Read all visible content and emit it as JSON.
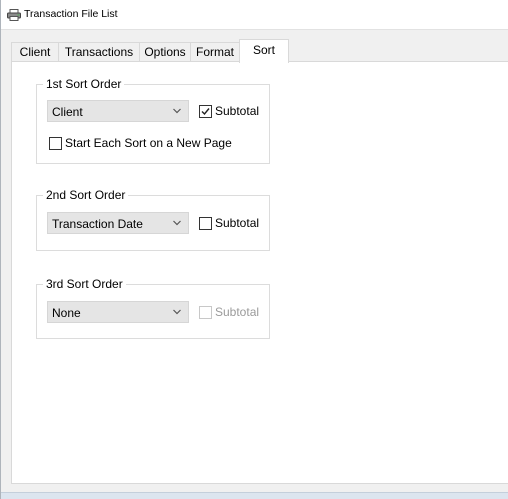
{
  "window": {
    "title": "Transaction File List",
    "title_icon": "printer-icon"
  },
  "tabs": [
    {
      "label": "Client"
    },
    {
      "label": "Transactions"
    },
    {
      "label": "Options"
    },
    {
      "label": "Format"
    },
    {
      "label": "Sort",
      "active": true
    }
  ],
  "sort_groups": [
    {
      "legend": "1st Sort Order",
      "combo_value": "Client",
      "subtotal_label": "Subtotal",
      "subtotal_checked": true,
      "subtotal_enabled": true,
      "new_page_label": "Start Each Sort on a New Page",
      "new_page_checked": false
    },
    {
      "legend": "2nd Sort Order",
      "combo_value": "Transaction Date",
      "subtotal_label": "Subtotal",
      "subtotal_checked": false,
      "subtotal_enabled": true
    },
    {
      "legend": "3rd Sort Order",
      "combo_value": "None",
      "subtotal_label": "Subtotal",
      "subtotal_checked": false,
      "subtotal_enabled": false
    }
  ]
}
